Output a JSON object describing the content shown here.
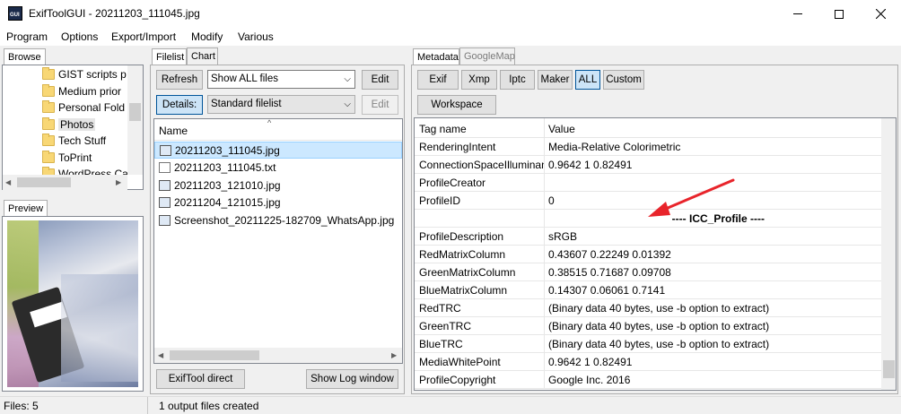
{
  "window": {
    "title": "ExifToolGUI - 20211203_111045.jpg",
    "icon_label": "GUI"
  },
  "menu": [
    "Program",
    "Options",
    "Export/Import",
    "Modify",
    "Various"
  ],
  "left": {
    "browse_tab": "Browse",
    "preview_tab": "Preview",
    "folders": [
      "GIST scripts p",
      "Medium prior",
      "Personal Fold",
      "Photos",
      "Tech Stuff",
      "ToPrint",
      "WordPress Ca"
    ],
    "selected_folder": "Photos"
  },
  "middle": {
    "tabs": [
      "Filelist",
      "Chart"
    ],
    "refresh_label": "Refresh",
    "filter_value": "Show ALL files",
    "edit_label": "Edit",
    "details_label": "Details:",
    "view_value": "Standard filelist",
    "edit2_label": "Edit",
    "column_name": "Name",
    "files": [
      {
        "name": "20211203_111045.jpg",
        "type": "image"
      },
      {
        "name": "20211203_111045.txt",
        "type": "text"
      },
      {
        "name": "20211203_121010.jpg",
        "type": "image"
      },
      {
        "name": "20211204_121015.jpg",
        "type": "image"
      },
      {
        "name": "Screenshot_20211225-182709_WhatsApp.jpg",
        "type": "image"
      }
    ],
    "exiftool_direct_label": "ExifTool direct",
    "show_log_label": "Show Log window"
  },
  "right": {
    "tabs": [
      "Metadata",
      "GoogleMap"
    ],
    "filter_buttons": [
      "Exif",
      "Xmp",
      "Iptc",
      "Maker",
      "ALL",
      "Custom"
    ],
    "active_filter": "ALL",
    "workspace_label": "Workspace",
    "col_tag": "Tag name",
    "col_value": "Value",
    "rows": [
      {
        "k": "RenderingIntent",
        "v": "Media-Relative Colorimetric"
      },
      {
        "k": "ConnectionSpaceIlluminant",
        "v": "0.9642 1 0.82491"
      },
      {
        "k": "ProfileCreator",
        "v": ""
      },
      {
        "k": "ProfileID",
        "v": "0"
      },
      {
        "k": "",
        "v": "---- ICC_Profile ----",
        "group": true
      },
      {
        "k": "ProfileDescription",
        "v": "sRGB"
      },
      {
        "k": "RedMatrixColumn",
        "v": "0.43607 0.22249 0.01392"
      },
      {
        "k": "GreenMatrixColumn",
        "v": "0.38515 0.71687 0.09708"
      },
      {
        "k": "BlueMatrixColumn",
        "v": "0.14307 0.06061 0.7141"
      },
      {
        "k": "RedTRC",
        "v": "(Binary data 40 bytes, use -b option to extract)"
      },
      {
        "k": "GreenTRC",
        "v": "(Binary data 40 bytes, use -b option to extract)"
      },
      {
        "k": "BlueTRC",
        "v": "(Binary data 40 bytes, use -b option to extract)"
      },
      {
        "k": "MediaWhitePoint",
        "v": "0.9642 1 0.82491"
      },
      {
        "k": "ProfileCopyright",
        "v": "Google Inc. 2016"
      }
    ]
  },
  "status": {
    "files": "Files: 5",
    "message": "1 output files created"
  },
  "colors": {
    "annotation_arrow": "#e8242b",
    "selection": "#cce8ff",
    "pressed_button": "#cce4f7"
  }
}
